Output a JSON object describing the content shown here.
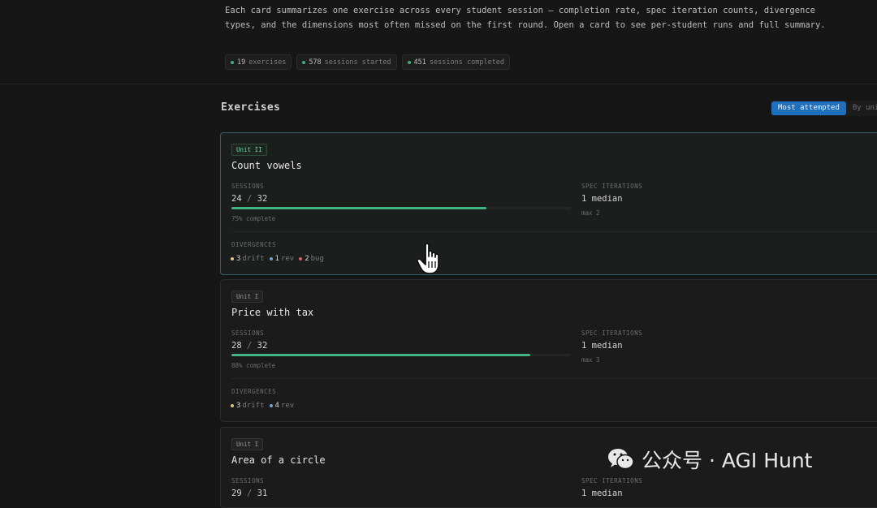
{
  "intro": {
    "text": "Each card summarizes one exercise across every student session — completion rate, spec iteration counts, divergence types, and the dimensions most often missed on the first round. Open a card to see per-student runs and full summary."
  },
  "stats": [
    {
      "num": "19",
      "label": "exercises"
    },
    {
      "num": "578",
      "label": "sessions started"
    },
    {
      "num": "451",
      "label": "sessions completed"
    }
  ],
  "section": {
    "title": "Exercises"
  },
  "sort": {
    "options": [
      "Most attempted",
      "By uni"
    ],
    "selected": "Most attempted"
  },
  "labels": {
    "sessions": "SESSIONS",
    "spec_iterations": "SPEC ITERATIONS",
    "divergences": "DIVERGENCES"
  },
  "cards": [
    {
      "unit": "Unit II",
      "title": "Count vowels",
      "sessions_done": "24",
      "sessions_total": "32",
      "progress": 0.75,
      "complete_text": "75% complete",
      "spec_median": "1 median",
      "spec_max": "max 2",
      "divergences": [
        {
          "count": "3",
          "label": "drift",
          "kind": "drift"
        },
        {
          "count": "1",
          "label": "rev",
          "kind": "rev"
        },
        {
          "count": "2",
          "label": "bug",
          "kind": "bug"
        }
      ]
    },
    {
      "unit": "Unit I",
      "title": "Price with tax",
      "sessions_done": "28",
      "sessions_total": "32",
      "progress": 0.88,
      "complete_text": "88% complete",
      "spec_median": "1 median",
      "spec_max": "max 3",
      "divergences": [
        {
          "count": "3",
          "label": "drift",
          "kind": "drift"
        },
        {
          "count": "4",
          "label": "rev",
          "kind": "rev"
        }
      ]
    },
    {
      "unit": "Unit I",
      "title": "Area of a circle",
      "sessions_done": "29",
      "sessions_total": "31",
      "spec_median": "1 median"
    }
  ],
  "separator": "/",
  "colors": {
    "accent_blue": "#1f6fbf",
    "progress_green": "#43b582",
    "drift": "#d8c780",
    "rev": "#6aa4d6",
    "bug": "#d0605a"
  },
  "watermark": {
    "text": "公众号 · AGI Hunt",
    "icon": "wechat-icon"
  },
  "cursor": {
    "icon": "hand-pointer-icon"
  }
}
